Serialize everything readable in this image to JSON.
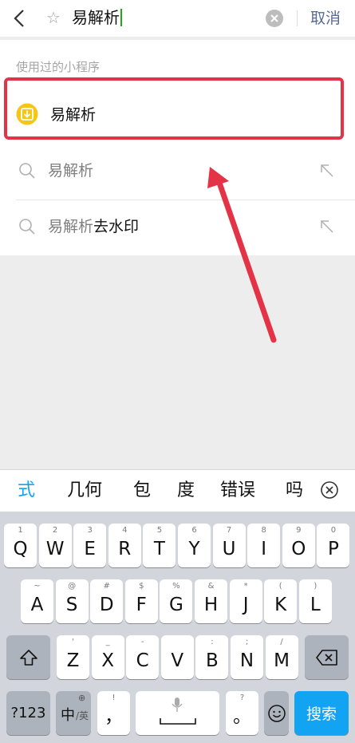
{
  "header": {
    "query": "易解析",
    "cancel_label": "取消"
  },
  "results": {
    "used_section_label": "使用过的小程序",
    "used_item_label": "易解析",
    "suggestions": [
      {
        "match": "易解析",
        "rest": ""
      },
      {
        "match": "易解析",
        "rest": "去水印"
      }
    ]
  },
  "candidates": [
    "式",
    "几何",
    "包",
    "度",
    "错误",
    "吗"
  ],
  "keyboard": {
    "row1": [
      {
        "sec": "1",
        "key": "Q"
      },
      {
        "sec": "2",
        "key": "W"
      },
      {
        "sec": "3",
        "key": "E"
      },
      {
        "sec": "4",
        "key": "R"
      },
      {
        "sec": "5",
        "key": "T"
      },
      {
        "sec": "6",
        "key": "Y"
      },
      {
        "sec": "7",
        "key": "U"
      },
      {
        "sec": "8",
        "key": "I"
      },
      {
        "sec": "9",
        "key": "O"
      },
      {
        "sec": "0",
        "key": "P"
      }
    ],
    "row2": [
      {
        "sec": "~",
        "key": "A"
      },
      {
        "sec": "@",
        "key": "S"
      },
      {
        "sec": "#",
        "key": "D"
      },
      {
        "sec": "$",
        "key": "F"
      },
      {
        "sec": "%",
        "key": "G"
      },
      {
        "sec": "&",
        "key": "H"
      },
      {
        "sec": "*",
        "key": "J"
      },
      {
        "sec": "(",
        "key": "K"
      },
      {
        "sec": ")",
        "key": "L"
      }
    ],
    "row3": [
      {
        "sec": "'",
        "key": "Z"
      },
      {
        "sec": "_",
        "key": "X"
      },
      {
        "sec": "-",
        "key": "C"
      },
      {
        "sec": "",
        "key": "V"
      },
      {
        "sec": ":",
        "key": "B"
      },
      {
        "sec": ";",
        "key": "N"
      },
      {
        "sec": "/",
        "key": "M"
      }
    ],
    "num_label": "?123",
    "lang_label": "中",
    "lang_sub": "/英",
    "comma_sec": "!",
    "comma_label": "，",
    "period_sec": "?",
    "period_label": "。",
    "search_label": "搜索"
  },
  "colors": {
    "accent_red": "#e43346",
    "search_key": "#12a3f2",
    "candidate_active": "#12a3f2",
    "cancel": "#576b95"
  }
}
